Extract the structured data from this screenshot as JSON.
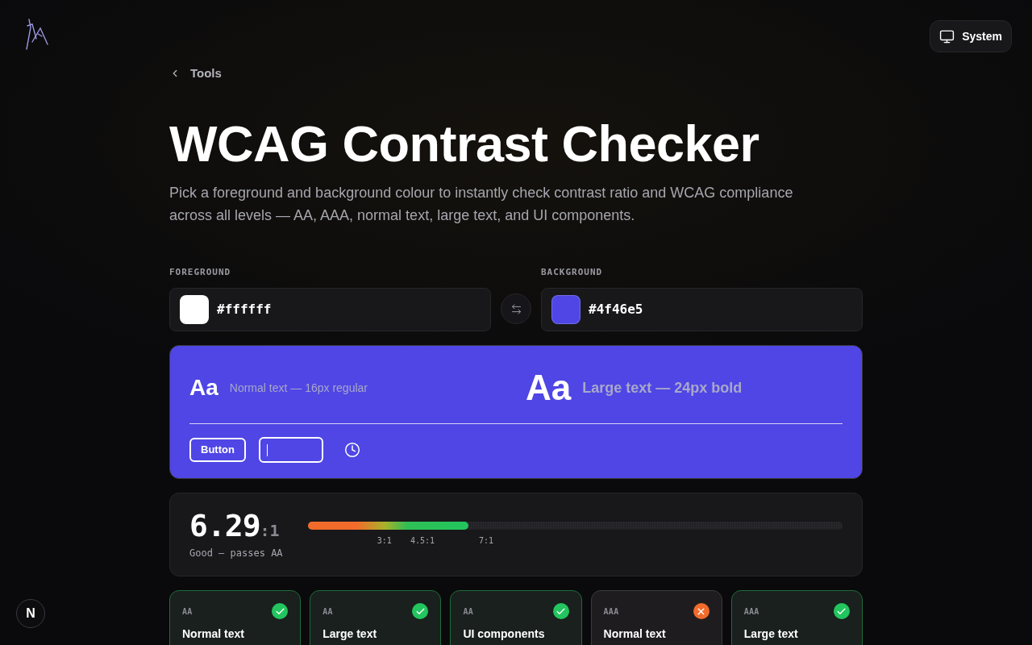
{
  "header": {
    "theme_button": "System"
  },
  "breadcrumb": {
    "back_link": "Tools"
  },
  "title": "WCAG Contrast Checker",
  "description": "Pick a foreground and background colour to instantly check contrast ratio and WCAG compliance across all levels — AA, AAA, normal text, large text, and UI components.",
  "colors": [
    {
      "label": "FOREGROUND",
      "value": "#ffffff",
      "color": "#ffffff"
    },
    {
      "label": "BACKGROUND",
      "value": "#4f46e5",
      "color": "#4f46e5"
    }
  ],
  "preview": {
    "normal_sample": "Aa",
    "normal_caption": "Normal text — 16px regular",
    "large_sample": "Aa",
    "large_caption": "Large text — 24px bold",
    "button": "Button"
  },
  "ratio": {
    "value": "6.29",
    "suffix": ":1",
    "verdict": "Good — passes AA",
    "level": 0.3,
    "ticks": [
      "3:1",
      "4.5:1",
      "7:1"
    ]
  },
  "results": [
    {
      "level": "AA",
      "label": "Normal text",
      "passed": true
    },
    {
      "level": "AA",
      "label": "Large text",
      "passed": true
    },
    {
      "level": "AA",
      "label": "UI components",
      "passed": true
    },
    {
      "level": "AAA",
      "label": "Normal text",
      "passed": false
    },
    {
      "level": "AAA",
      "label": "Large text",
      "passed": true
    }
  ],
  "dev_badge": "N"
}
